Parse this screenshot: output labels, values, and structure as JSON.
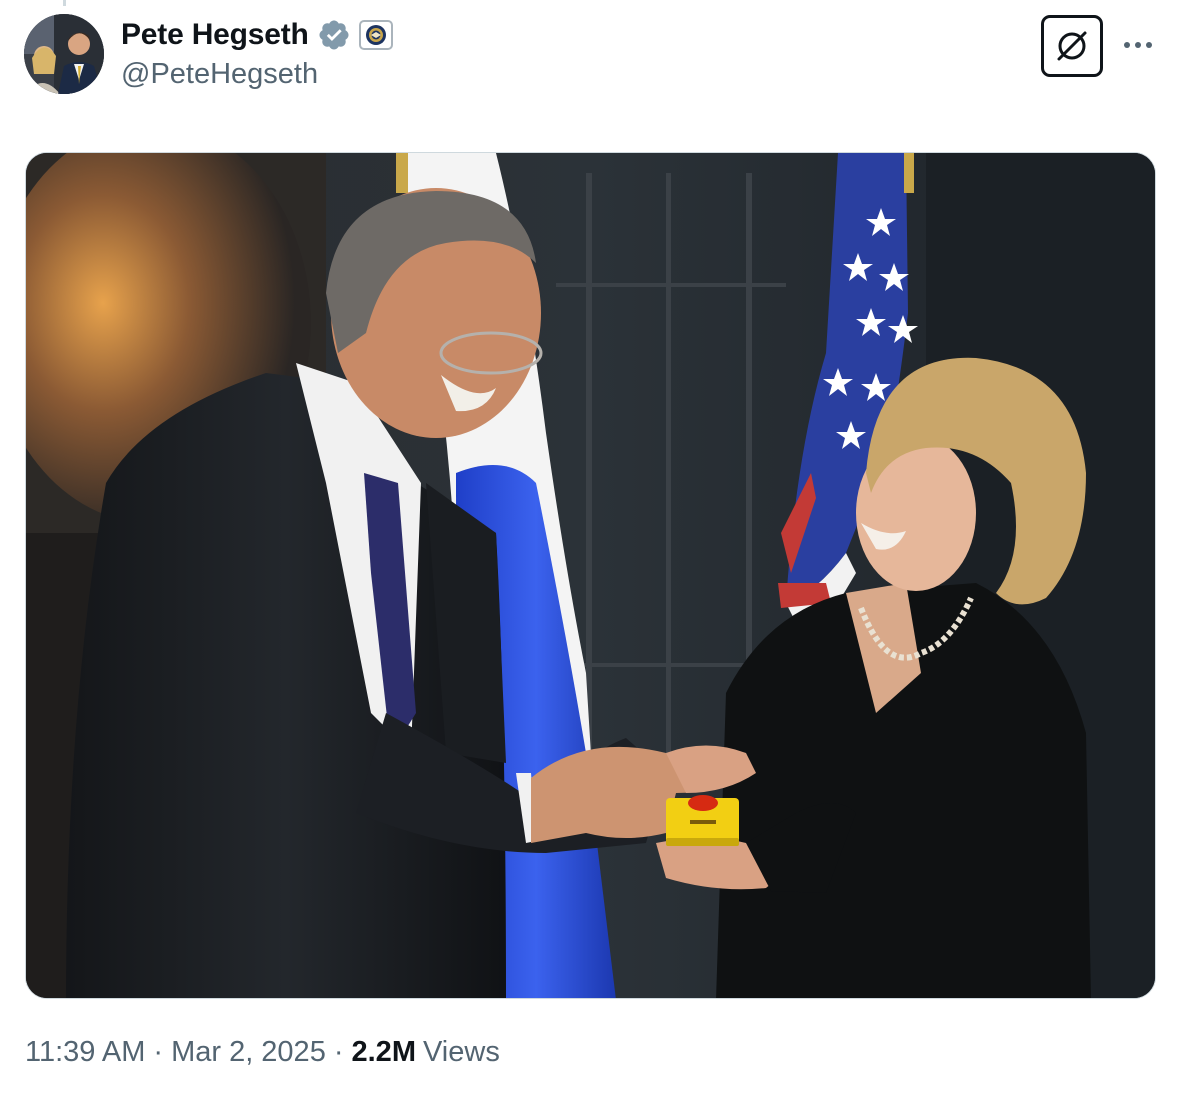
{
  "author": {
    "display_name": "Pete Hegseth",
    "handle": "@PeteHegseth",
    "verified_badge_icon": "verified-badge-icon",
    "affiliation_icon": "dod-seal-icon",
    "avatar_icon": "profile-avatar"
  },
  "header_actions": {
    "grok_icon": "grok-icon",
    "more_icon": "more-options-icon"
  },
  "media": {
    "icon": "photo-media"
  },
  "meta": {
    "time": "11:39 AM",
    "separator": "·",
    "date": "Mar 2, 2025",
    "views_count": "2.2M",
    "views_label": "Views"
  },
  "colors": {
    "text_primary": "#0f1419",
    "text_secondary": "#536471",
    "verified_badge": "#829aab",
    "border": "#cfd9de",
    "button_yellow": "#f2cf13",
    "button_red": "#d62a12"
  }
}
